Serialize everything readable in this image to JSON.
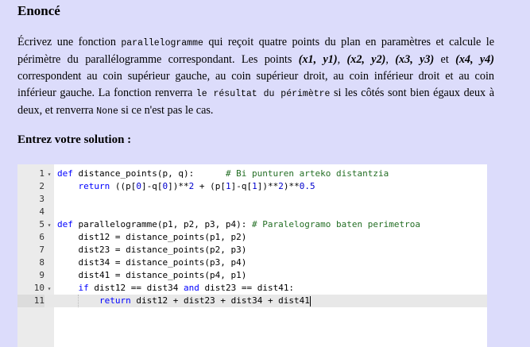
{
  "heading": "Enoncé",
  "statement": {
    "p1": "Écrivez une fonction ",
    "fn_name": "parallelogramme",
    "p2": " qui reçoit quatre points du plan en paramètres et calcule le périmètre du parallélogramme correspondant. Les points ",
    "pt1": "(x1, y1)",
    "pt2": "(x2, y2)",
    "pt3": "(x3, y3)",
    "pt4": "(x4, y4)",
    "p3": " correspondent au coin supérieur gauche, au coin supérieur droit, au coin inférieur droit et au coin inférieur gauche. La fonction renverra ",
    "result_text": "le résultat du périmètre",
    "p4": " si les côtés sont bien égaux deux à deux, et renverra ",
    "none_text": "None",
    "p5": " si ce n'est pas le cas."
  },
  "solution_label": "Entrez votre solution :",
  "editor": {
    "lines": [
      {
        "n": "1",
        "fold": true,
        "code": "def distance_points(p, q):      # Bi punturen arteko distantzia"
      },
      {
        "n": "2",
        "fold": false,
        "code": "    return ((p[0]-q[0])**2 + (p[1]-q[1])**2)**0.5"
      },
      {
        "n": "3",
        "fold": false,
        "code": ""
      },
      {
        "n": "4",
        "fold": false,
        "code": ""
      },
      {
        "n": "5",
        "fold": true,
        "code": "def parallelogramme(p1, p2, p3, p4): # Paralelogramo baten perimetroa"
      },
      {
        "n": "6",
        "fold": false,
        "code": "    dist12 = distance_points(p1, p2)"
      },
      {
        "n": "7",
        "fold": false,
        "code": "    dist23 = distance_points(p2, p3)"
      },
      {
        "n": "8",
        "fold": false,
        "code": "    dist34 = distance_points(p3, p4)"
      },
      {
        "n": "9",
        "fold": false,
        "code": "    dist41 = distance_points(p4, p1)"
      },
      {
        "n": "10",
        "fold": true,
        "code": "    if dist12 == dist34 and dist23 == dist41:"
      },
      {
        "n": "11",
        "fold": false,
        "code": "        return dist12 + dist23 + dist34 + dist41"
      }
    ],
    "active_line": "11"
  }
}
